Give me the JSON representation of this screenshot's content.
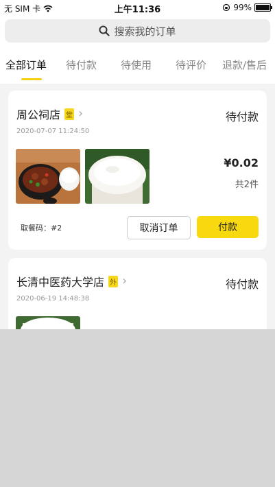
{
  "status_bar": {
    "carrier": "无 SIM 卡",
    "time": "上午11:36",
    "battery": "99%",
    "battery_level": 0.99
  },
  "search": {
    "placeholder": "搜索我的订单"
  },
  "tabs": [
    {
      "label": "全部订单",
      "active": true
    },
    {
      "label": "待付款",
      "active": false
    },
    {
      "label": "待使用",
      "active": false
    },
    {
      "label": "待评价",
      "active": false
    },
    {
      "label": "退款/售后",
      "active": false
    }
  ],
  "colors": {
    "accent": "#f8d90f",
    "tag_bg": "#f7d71c"
  },
  "orders": [
    {
      "store": "周公祠店",
      "tag": "堂",
      "status": "待付款",
      "time": "2020-07-07 11:24:50",
      "price": "¥0.02",
      "count": "共2件",
      "pickup": "取餐码：#2",
      "cancel_label": "取消订单",
      "pay_label": "付款"
    },
    {
      "store": "长清中医药大学店",
      "tag": "外",
      "status": "待付款",
      "time": "2020-06-19 14:48:38"
    }
  ]
}
